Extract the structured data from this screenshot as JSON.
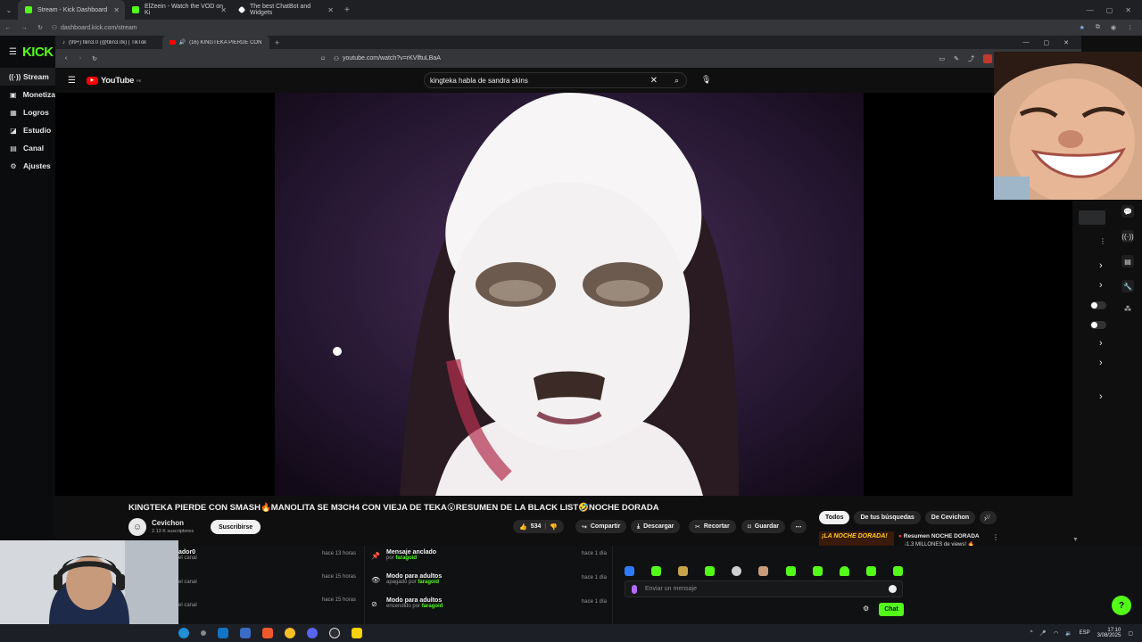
{
  "outer_tabs": [
    {
      "label": "Stream - Kick Dashboard",
      "favicon_color": "#53fc18",
      "active": true
    },
    {
      "label": "ElZeein - Watch the VOD on Ki",
      "favicon_color": "#53fc18",
      "active": false
    },
    {
      "label": "The best ChatBot and Widgets",
      "favicon_color": "#ffffff",
      "active": false
    }
  ],
  "outer_address": "dashboard.kick.com/stream",
  "kick": {
    "logo": "KICK",
    "nav": [
      {
        "label": "Stream",
        "icon": "stream-icon"
      },
      {
        "label": "Monetiza",
        "icon": "monetize-icon"
      },
      {
        "label": "Logros",
        "icon": "achievements-icon"
      },
      {
        "label": "Estudio",
        "icon": "studio-icon"
      },
      {
        "label": "Canal",
        "icon": "channel-icon"
      },
      {
        "label": "Ajustes",
        "icon": "gear-icon"
      }
    ]
  },
  "inner_tabs": [
    {
      "label": "(99+) tilin3.0 (@tilin3.0k) | TikTok",
      "active": false
    },
    {
      "label": "(16) KINGTEKA PIERDE CON S",
      "active": true
    }
  ],
  "inner_address": "youtube.com/watch?v=rKVlftuLBaA",
  "youtube": {
    "logo": "YouTube",
    "region": "PE",
    "search_query": "kingteka habla de sandra skins",
    "video_title": "KINGTEKA PIERDE CON SMASH🔥MANOLITA SE M3CH4 CON VIEJA DE TEKA😮RESUMEN DE LA BLACK LIST🤣NOCHE DORADA",
    "channel": {
      "name": "Cevichon",
      "subscribers": "2.13 K suscriptores",
      "subscribe_label": "Suscribirse"
    },
    "actions": {
      "likes": "534",
      "share": "Compartir",
      "download": "Descargar",
      "clip": "Recortar",
      "save": "Guardar"
    },
    "chips": [
      "Todos",
      "De tus búsquedas",
      "De Cevichon",
      "V"
    ],
    "suggested": {
      "thumb_text": "¡LA NOCHE DORADA!",
      "title": "Resumen NOCHE DORADA",
      "subtitle": "¡1.3 MILLONES de views! 🔥"
    }
  },
  "activity_left": [
    {
      "title": "ador0",
      "sub": "el canal",
      "time": "hace 13 horas"
    },
    {
      "title": "",
      "sub": "el canal",
      "time": "hace 15 horas"
    },
    {
      "title": "",
      "sub": "el canal",
      "time": "hace 15 horas"
    }
  ],
  "activity_right": [
    {
      "icon": "pin-icon",
      "title": "Mensaje anclado",
      "sub_prefix": "por",
      "user": "faragoid",
      "time": "hace 1 día"
    },
    {
      "icon": "eye-icon",
      "title": "Modo para adultos",
      "sub_prefix": "apagado por",
      "user": "faragoid",
      "time": "hace 1 día"
    },
    {
      "icon": "eye-off-icon",
      "title": "Modo para adultos",
      "sub_prefix": "encendido por",
      "user": "faragoid",
      "time": "hace 1 día"
    }
  ],
  "chat": {
    "placeholder": "Enviar un mensaje",
    "send_label": "Chat"
  },
  "emote_colors": [
    "#2f7bff",
    "#53fc18",
    "#c8a24a",
    "#53fc18",
    "#d0d0d0",
    "#c89b7b",
    "#53fc18",
    "#53fc18",
    "#53fc18",
    "#53fc18",
    "#53fc18"
  ],
  "taskbar": {
    "lang": "ESP",
    "time": "17:10",
    "date": "3/08/2025"
  },
  "colors": {
    "kick_green": "#53fc18",
    "yt_red": "#ff0000"
  }
}
